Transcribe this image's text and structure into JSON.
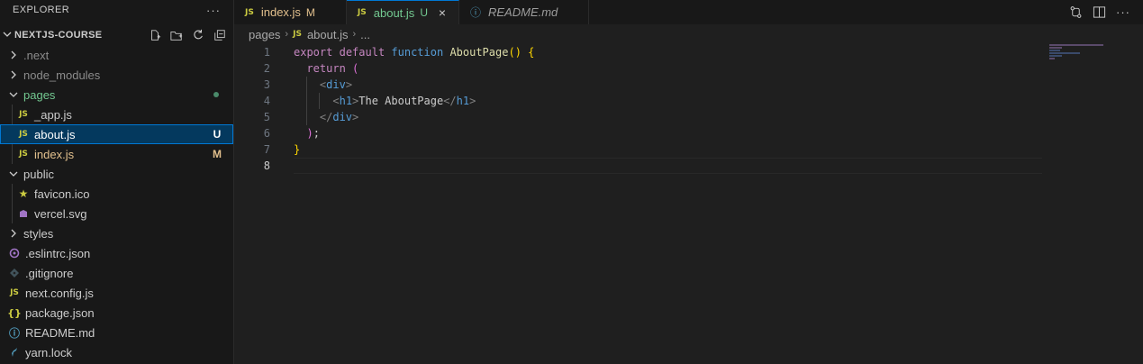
{
  "explorer": {
    "title": "EXPLORER",
    "more_label": "···",
    "project": "NEXTJS-COURSE",
    "tree": [
      {
        "name": ".next",
        "type": "folder",
        "state": "collapsed",
        "level": 0
      },
      {
        "name": "node_modules",
        "type": "folder",
        "state": "collapsed",
        "level": 0
      },
      {
        "name": "pages",
        "type": "folder",
        "state": "expanded",
        "level": 0,
        "status": "dot"
      },
      {
        "name": "_app.js",
        "type": "js",
        "level": 1
      },
      {
        "name": "about.js",
        "type": "js",
        "level": 1,
        "badge": "U",
        "selected": true
      },
      {
        "name": "index.js",
        "type": "js",
        "level": 1,
        "badge": "M"
      },
      {
        "name": "public",
        "type": "folder",
        "state": "expanded",
        "level": 0
      },
      {
        "name": "favicon.ico",
        "type": "star",
        "level": 1
      },
      {
        "name": "vercel.svg",
        "type": "svg",
        "level": 1
      },
      {
        "name": "styles",
        "type": "folder",
        "state": "collapsed",
        "level": 0
      },
      {
        "name": ".eslintrc.json",
        "type": "eslint",
        "level": 0
      },
      {
        "name": ".gitignore",
        "type": "git",
        "level": 0
      },
      {
        "name": "next.config.js",
        "type": "js",
        "level": 0
      },
      {
        "name": "package.json",
        "type": "json",
        "level": 0
      },
      {
        "name": "README.md",
        "type": "info",
        "level": 0
      },
      {
        "name": "yarn.lock",
        "type": "yarn",
        "level": 0
      }
    ]
  },
  "tabs": [
    {
      "icon": "JS",
      "name": "index.js",
      "badge": "M",
      "active": false
    },
    {
      "icon": "JS",
      "name": "about.js",
      "badge": "U",
      "active": true,
      "close": "×"
    },
    {
      "icon": "ⓘ",
      "name": "README.md",
      "italic": true,
      "active": false
    }
  ],
  "breadcrumb": {
    "folder": "pages",
    "icon": "JS",
    "file": "about.js",
    "tail": "..."
  },
  "code": {
    "line_numbers": [
      "1",
      "2",
      "3",
      "4",
      "5",
      "6",
      "7",
      "8"
    ],
    "lines": [
      [
        [
          "kw",
          "export"
        ],
        [
          "t",
          " "
        ],
        [
          "kw",
          "default"
        ],
        [
          "t",
          " "
        ],
        [
          "kw2",
          "function"
        ],
        [
          "t",
          " "
        ],
        [
          "fn",
          "AboutPage"
        ],
        [
          "br",
          "()"
        ],
        [
          "t",
          " "
        ],
        [
          "br",
          "{"
        ]
      ],
      [
        [
          "t",
          "  "
        ],
        [
          "kw",
          "return"
        ],
        [
          "t",
          " "
        ],
        [
          "br2",
          "("
        ]
      ],
      [
        [
          "t",
          "    "
        ],
        [
          "tgb",
          "<"
        ],
        [
          "tg",
          "div"
        ],
        [
          "tgb",
          ">"
        ]
      ],
      [
        [
          "t",
          "      "
        ],
        [
          "tgb",
          "<"
        ],
        [
          "tg",
          "h1"
        ],
        [
          "tgb",
          ">"
        ],
        [
          "t",
          "The AboutPage"
        ],
        [
          "tgb",
          "</"
        ],
        [
          "tg",
          "h1"
        ],
        [
          "tgb",
          ">"
        ]
      ],
      [
        [
          "t",
          "    "
        ],
        [
          "tgb",
          "</"
        ],
        [
          "tg",
          "div"
        ],
        [
          "tgb",
          ">"
        ]
      ],
      [
        [
          "t",
          "  "
        ],
        [
          "br2",
          ")"
        ],
        [
          "t",
          ";"
        ]
      ],
      [
        [
          "br",
          "}"
        ]
      ],
      []
    ]
  },
  "colors": {
    "accent": "#0078d4",
    "untracked": "#73c991",
    "modified": "#e2c08d",
    "js_icon": "#cbcb41"
  }
}
